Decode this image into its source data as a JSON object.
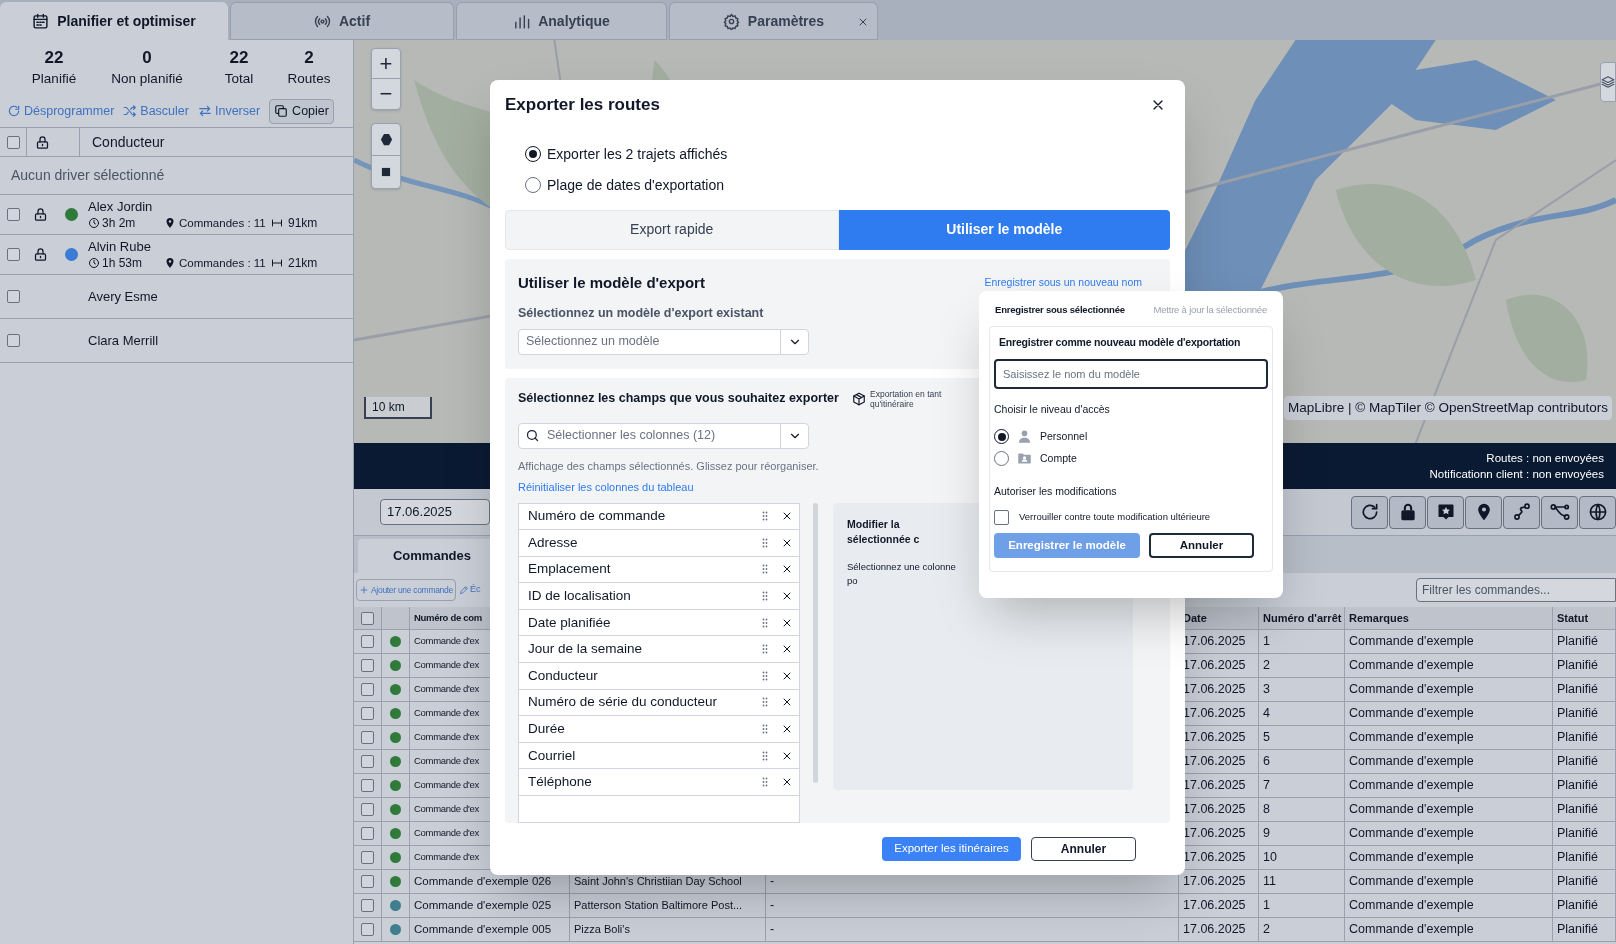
{
  "app_tabs": [
    {
      "label": "Planifier et optimiser",
      "selected": true,
      "closable": false
    },
    {
      "label": "Actif",
      "selected": false,
      "closable": false
    },
    {
      "label": "Analytique",
      "selected": false,
      "closable": false
    },
    {
      "label": "Paramètres",
      "selected": false,
      "closable": true
    }
  ],
  "summary": [
    {
      "value": "22",
      "label": "Planifié"
    },
    {
      "value": "0",
      "label": "Non planifié"
    },
    {
      "value": "22",
      "label": "Total"
    },
    {
      "value": "2",
      "label": "Routes"
    }
  ],
  "actions": [
    {
      "label": "Désprogrammer",
      "kind": "link"
    },
    {
      "label": "Basculer",
      "kind": "link"
    },
    {
      "label": "Inverser",
      "kind": "link"
    },
    {
      "label": "Copier",
      "kind": "button"
    }
  ],
  "drivers": {
    "select_all_checked": false,
    "header": "Conducteur",
    "empty_text": "Aucun driver sélectionné",
    "rows": [
      {
        "name": "Alex Jordin",
        "checked": false,
        "locked": true,
        "color": "#2f7a3a",
        "duration": "3h 2m",
        "orders": "Commandes : 11",
        "distance": "91km"
      },
      {
        "name": "Alvin Rube",
        "checked": false,
        "locked": true,
        "color": "#3a7bd5",
        "duration": "1h 53m",
        "orders": "Commandes : 11",
        "distance": "21km"
      },
      {
        "name": "Avery Esme",
        "checked": false,
        "locked": false
      },
      {
        "name": "Clara Merrill",
        "checked": false,
        "locked": false
      }
    ]
  },
  "map": {
    "zoom_in": "+",
    "zoom_out": "−",
    "scale": "10 km",
    "attribution": "MapLibre | © MapTiler © OpenStreetMap contributors"
  },
  "status": [
    "Routes : non envoyées",
    "Notificationn client : non envoyées"
  ],
  "date": "17.06.2025",
  "orders_tabs": [
    {
      "label": "Commandes",
      "selected": true
    }
  ],
  "orders_actions": [
    {
      "label": "Ajouter une commande"
    },
    {
      "label": "Éc"
    }
  ],
  "filter_placeholder": "Filtrer les commandes...",
  "orders_table": {
    "select_all_checked": false,
    "columns": [
      "Numéro de com",
      "Date",
      "Numéro d'arrêt",
      "Remarques",
      "Statut"
    ],
    "rows": [
      {
        "checked": false,
        "color": "#2f7a3a",
        "order": "Commande d'ex",
        "date": "17.06.2025",
        "stop": "1",
        "remarks": "Commande d'exemple",
        "status": "Planifié"
      },
      {
        "checked": false,
        "color": "#2f7a3a",
        "order": "Commande d'ex",
        "date": "17.06.2025",
        "stop": "2",
        "remarks": "Commande d'exemple",
        "status": "Planifié"
      },
      {
        "checked": false,
        "color": "#2f7a3a",
        "order": "Commande d'ex",
        "date": "17.06.2025",
        "stop": "3",
        "remarks": "Commande d'exemple",
        "status": "Planifié"
      },
      {
        "checked": false,
        "color": "#2f7a3a",
        "order": "Commande d'ex",
        "date": "17.06.2025",
        "stop": "4",
        "remarks": "Commande d'exemple",
        "status": "Planifié"
      },
      {
        "checked": false,
        "color": "#2f7a3a",
        "order": "Commande d'ex",
        "date": "17.06.2025",
        "stop": "5",
        "remarks": "Commande d'exemple",
        "status": "Planifié"
      },
      {
        "checked": false,
        "color": "#2f7a3a",
        "order": "Commande d'ex",
        "date": "17.06.2025",
        "stop": "6",
        "remarks": "Commande d'exemple",
        "status": "Planifié"
      },
      {
        "checked": false,
        "color": "#2f7a3a",
        "order": "Commande d'ex",
        "date": "17.06.2025",
        "stop": "7",
        "remarks": "Commande d'exemple",
        "status": "Planifié"
      },
      {
        "checked": false,
        "color": "#2f7a3a",
        "order": "Commande d'ex",
        "date": "17.06.2025",
        "stop": "8",
        "remarks": "Commande d'exemple",
        "status": "Planifié"
      },
      {
        "checked": false,
        "color": "#2f7a3a",
        "order": "Commande d'ex",
        "date": "17.06.2025",
        "stop": "9",
        "remarks": "Commande d'exemple",
        "status": "Planifié"
      },
      {
        "checked": false,
        "color": "#2f7a3a",
        "order": "Commande d'ex",
        "date": "17.06.2025",
        "stop": "10",
        "remarks": "Commande d'exemple",
        "status": "Planifié"
      },
      {
        "checked": false,
        "color": "#2f7a3a",
        "order": "Commande d'exemple 026",
        "address": "Saint John's Christiian Day School",
        "extra": "-",
        "date": "17.06.2025",
        "stop": "11",
        "remarks": "Commande d'exemple",
        "status": "Planifié"
      },
      {
        "checked": false,
        "color": "#3f7e8c",
        "order": "Commande d'exemple 025",
        "address": "Patterson Station Baltimore Post...",
        "extra": "-",
        "date": "17.06.2025",
        "stop": "1",
        "remarks": "Commande d'exemple",
        "status": "Planifié"
      },
      {
        "checked": false,
        "color": "#3f7e8c",
        "order": "Commande d'exemple 005",
        "address": "Pizza Boli's",
        "extra": "-",
        "date": "17.06.2025",
        "stop": "2",
        "remarks": "Commande d'exemple",
        "status": "Planifié"
      }
    ]
  },
  "export_dialog": {
    "title": "Exporter les routes",
    "scope_options": [
      {
        "label": "Exporter les 2 trajets affichés",
        "selected": true
      },
      {
        "label": "Plage de dates d'exportation",
        "selected": false
      }
    ],
    "modes": [
      {
        "label": "Export rapide",
        "selected": false
      },
      {
        "label": "Utiliser le modèle",
        "selected": true
      }
    ],
    "template_section": {
      "title": "Utiliser le modèle d'export",
      "save_link": "Enregistrer sous un nouveau nom",
      "select_label": "Sélectionnez un modèle d'export existant",
      "select_placeholder": "Sélectionnez un modèle"
    },
    "fields_section": {
      "title": "Sélectionnez les champs que vous souhaitez exporter",
      "itinerary_option": "Exportation en tant qu'itinéraire",
      "columns_placeholder": "Sélectionner les colonnes (12)",
      "hint": "Affichage des champs sélectionnés. Glissez pour réorganiser.",
      "reset_link": "Réinitialiser les colonnes du tableau",
      "fields": [
        "Numéro de commande",
        "Adresse",
        "Emplacement",
        "ID de localisation",
        "Date planifiée",
        "Jour de la semaine",
        "Conducteur",
        "Numéro de série du conducteur",
        "Durée",
        "Courriel",
        "Téléphone"
      ],
      "editor_title": "Modifier la sélectionnée c",
      "editor_hint": "Sélectionnez une colonne po"
    },
    "buttons": [
      {
        "label": "Exporter les itinéraires",
        "kind": "primary"
      },
      {
        "label": "Annuler",
        "kind": "secondary"
      }
    ]
  },
  "save_popover": {
    "tabs": [
      {
        "label": "Enregistrer sous sélectionnée",
        "selected": true
      },
      {
        "label": "Mettre à jour la sélectionnée",
        "selected": false
      }
    ],
    "title": "Enregistrer comme nouveau modèle d'exportation",
    "name_placeholder": "Saisissez le nom du modèle",
    "access_label": "Choisir le niveau d'accès",
    "access_options": [
      {
        "label": "Personnel",
        "selected": true
      },
      {
        "label": "Compte",
        "selected": false
      }
    ],
    "permissions_label": "Autoriser les modifications",
    "lock_option": {
      "label": "Verrouiller contre toute modification ultérieure",
      "checked": false
    },
    "buttons": [
      {
        "label": "Enregistrer le modèle",
        "disabled": true
      },
      {
        "label": "Annuler",
        "disabled": false
      }
    ]
  }
}
